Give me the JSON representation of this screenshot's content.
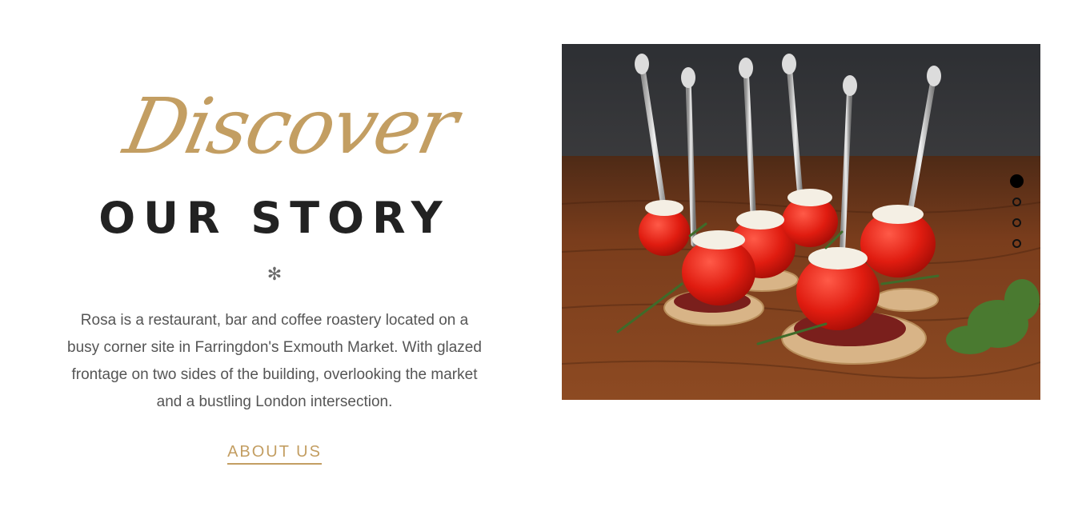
{
  "story": {
    "script_heading": "Discover",
    "title": "OUR STORY",
    "divider_symbol": "✻",
    "description": "Rosa is a restaurant, bar and coffee roastery located on a busy corner site in Farringdon's Exmouth Market. With glazed frontage on two sides of the building, overlooking the market and a bustling London intersection.",
    "link_label": "ABOUT US"
  },
  "slider": {
    "image_subject": "cherry-tomato-appetizers-on-skewers",
    "active_index": 0,
    "dot_count": 4
  },
  "colors": {
    "accent_gold": "#c39e62",
    "title_dark": "#222222",
    "body_text": "#555555",
    "background": "#ffffff"
  }
}
